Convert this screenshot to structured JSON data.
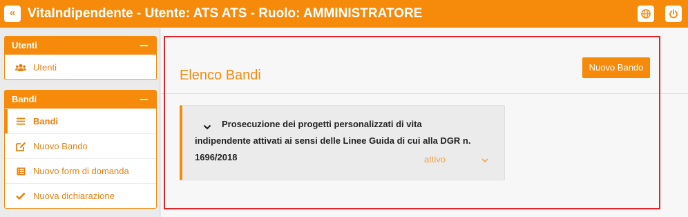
{
  "header": {
    "back_label": "«",
    "title": "VitaIndipendente - Utente: ATS ATS - Ruolo: AMMINISTRATORE",
    "globe_icon": "globe-icon",
    "power_icon": "power-icon"
  },
  "sidebar": {
    "utenti_panel": {
      "title": "Utenti",
      "items": [
        {
          "label": "Utenti",
          "icon": "users-icon"
        }
      ]
    },
    "bandi_panel": {
      "title": "Bandi",
      "items": [
        {
          "label": "Bandi",
          "icon": "list-icon",
          "active": true
        },
        {
          "label": "Nuovo Bando",
          "icon": "edit-icon"
        },
        {
          "label": "Nuovo form di domanda",
          "icon": "form-icon"
        },
        {
          "label": "Nuova dichiarazione",
          "icon": "check-icon"
        }
      ]
    }
  },
  "main": {
    "title": "Elenco Bandi",
    "new_button": "Nuovo Bando",
    "cards": [
      {
        "title_line1": "Prosecuzione dei progetti personalizzati di vita",
        "title_rest": "indipendente attivati ai sensi delle Linee Guida di cui alla DGR n. 1696/2018",
        "status": "attivo"
      }
    ]
  },
  "colors": {
    "accent": "#f58a0b",
    "highlight": "#e0242b"
  }
}
